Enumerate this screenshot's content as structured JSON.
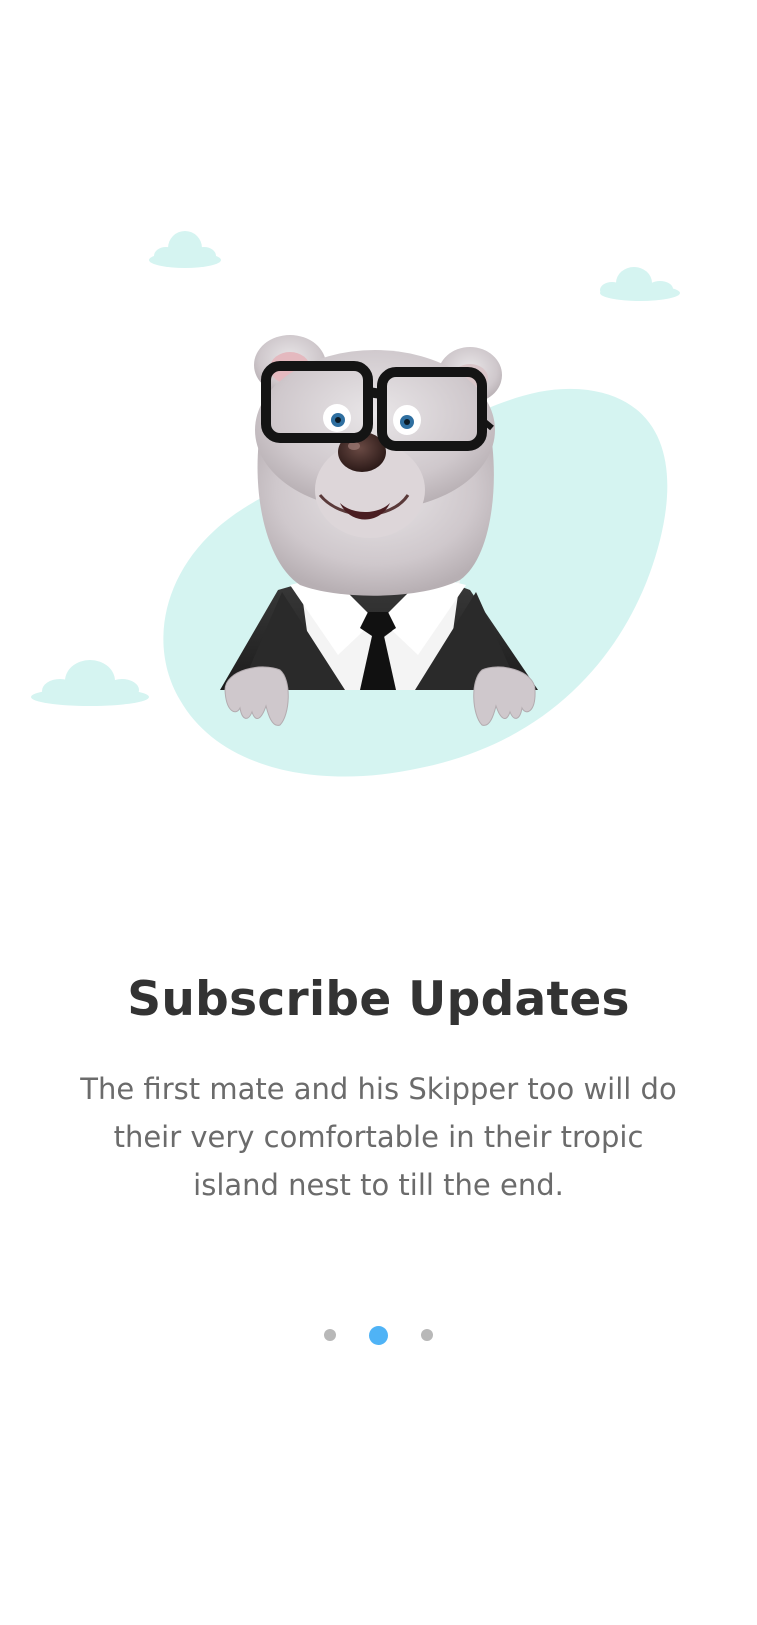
{
  "onboarding": {
    "title": "Subscribe Updates",
    "description": "The first mate and his Skipper too will do their very comfortable in their tropic island nest to till the end.",
    "pager": {
      "total": 3,
      "active_index": 1
    }
  },
  "colors": {
    "accent": "#4fb3f6",
    "blob": "#d5f4f1",
    "cloud": "#d5f4f1",
    "inactive_dot": "#b8b8b8",
    "title": "#333333",
    "body_text": "#6b6b6b"
  },
  "illustration": {
    "character": "bear-in-suit-with-glasses"
  }
}
